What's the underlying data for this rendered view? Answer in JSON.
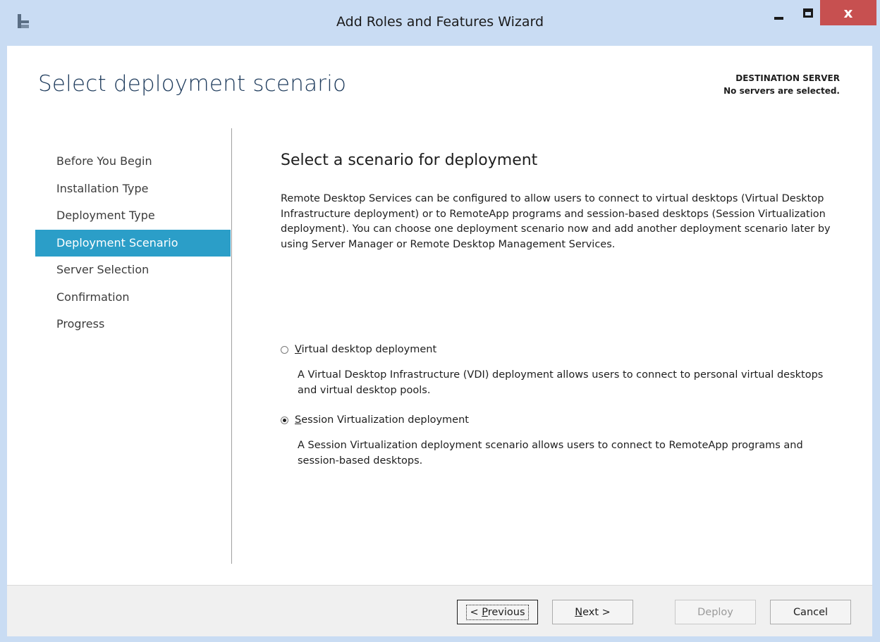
{
  "window": {
    "title": "Add Roles and Features Wizard",
    "close_glyph": "x"
  },
  "header": {
    "page_title": "Select deployment scenario",
    "destination_label": "DESTINATION SERVER",
    "destination_value": "No servers are selected."
  },
  "nav": {
    "items": [
      {
        "label": "Before You Begin",
        "active": false
      },
      {
        "label": "Installation Type",
        "active": false
      },
      {
        "label": "Deployment Type",
        "active": false
      },
      {
        "label": "Deployment Scenario",
        "active": true
      },
      {
        "label": "Server Selection",
        "active": false
      },
      {
        "label": "Confirmation",
        "active": false
      },
      {
        "label": "Progress",
        "active": false
      }
    ]
  },
  "main": {
    "heading": "Select a scenario for deployment",
    "description": "Remote Desktop Services can be configured to allow users to connect to virtual desktops (Virtual Desktop Infrastructure deployment) or to RemoteApp programs and session-based desktops (Session Virtualization deployment). You can choose one deployment scenario now and add another deployment scenario later by using Server Manager or Remote Desktop Management Services.",
    "options": [
      {
        "accel": "V",
        "label_rest": "irtual desktop deployment",
        "checked": false,
        "description": "A Virtual Desktop Infrastructure (VDI) deployment allows users to connect to personal virtual desktops and virtual desktop pools."
      },
      {
        "accel": "S",
        "label_rest": "ession Virtualization deployment",
        "checked": true,
        "description": "A Session Virtualization deployment scenario allows users to connect to RemoteApp programs and session-based desktops."
      }
    ]
  },
  "footer": {
    "previous_prefix": "< ",
    "previous_accel": "P",
    "previous_rest": "revious",
    "next_accel": "N",
    "next_rest": "ext >",
    "deploy": "Deploy",
    "cancel": "Cancel"
  },
  "colors": {
    "title_bar": "#c9dcf3",
    "nav_active": "#2b9ec8",
    "close_button": "#c75050"
  }
}
